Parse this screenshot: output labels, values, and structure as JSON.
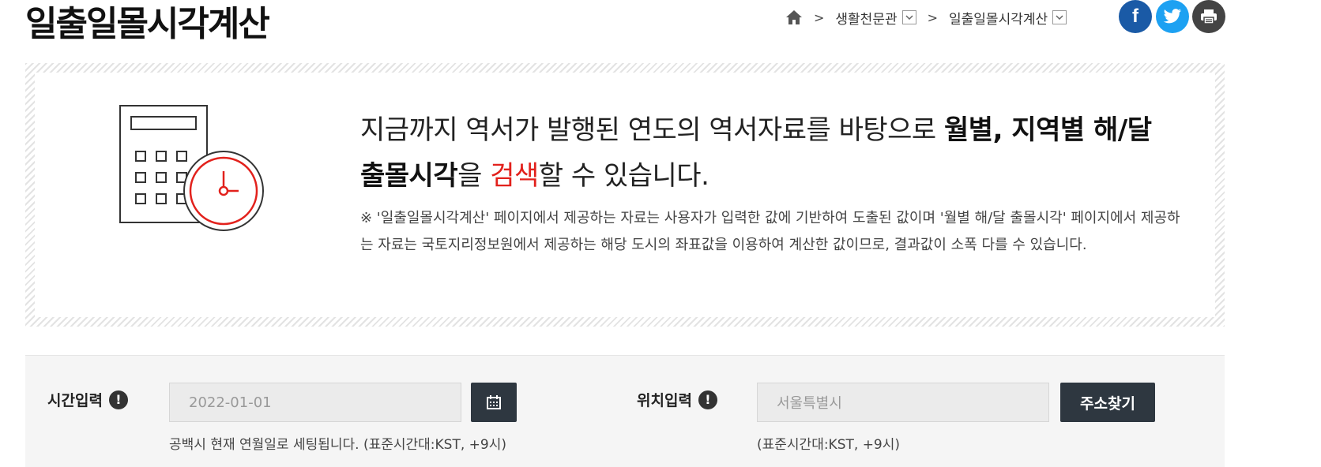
{
  "page": {
    "title": "일출일몰시각계산"
  },
  "breadcrumb": {
    "level1": "생활천문관",
    "level2": "일출일몰시각계산"
  },
  "social": {
    "facebook": "f"
  },
  "banner": {
    "lead_part1": "지금까지 역서가 발행된 연도의 역서자료를 바탕으로 ",
    "lead_bold1": "월별, 지역별 해/달",
    "lead_bold2": "출몰시각",
    "lead_part2": "을 ",
    "lead_highlight": "검색",
    "lead_part3": "할 수 있습니다.",
    "note": "※ '일출일몰시각계산' 페이지에서 제공하는 자료는 사용자가 입력한 값에 기반하여 도출된 값이며 '월별 해/달 출몰시각' 페이지에서 제공하는 자료는 국토지리정보원에서 제공하는 해당 도시의 좌표값을 이용하여 계산한 값이므로, 결과값이 소폭 다를 수 있습니다."
  },
  "form": {
    "time_label": "시간입력",
    "time_info": "!",
    "date_placeholder": "2022-01-01",
    "time_hint": "공백시 현재 연월일로 세팅됩니다. (표준시간대:KST, +9시)",
    "location_label": "위치입력",
    "location_info": "!",
    "location_placeholder": "서울특별시",
    "address_button": "주소찾기",
    "location_hint": "(표준시간대:KST, +9시)"
  },
  "colors": {
    "accent_red": "#e2211c",
    "button_dark": "#2e3740",
    "facebook": "#1a5aa6",
    "twitter": "#1da1f2",
    "print": "#444444"
  }
}
